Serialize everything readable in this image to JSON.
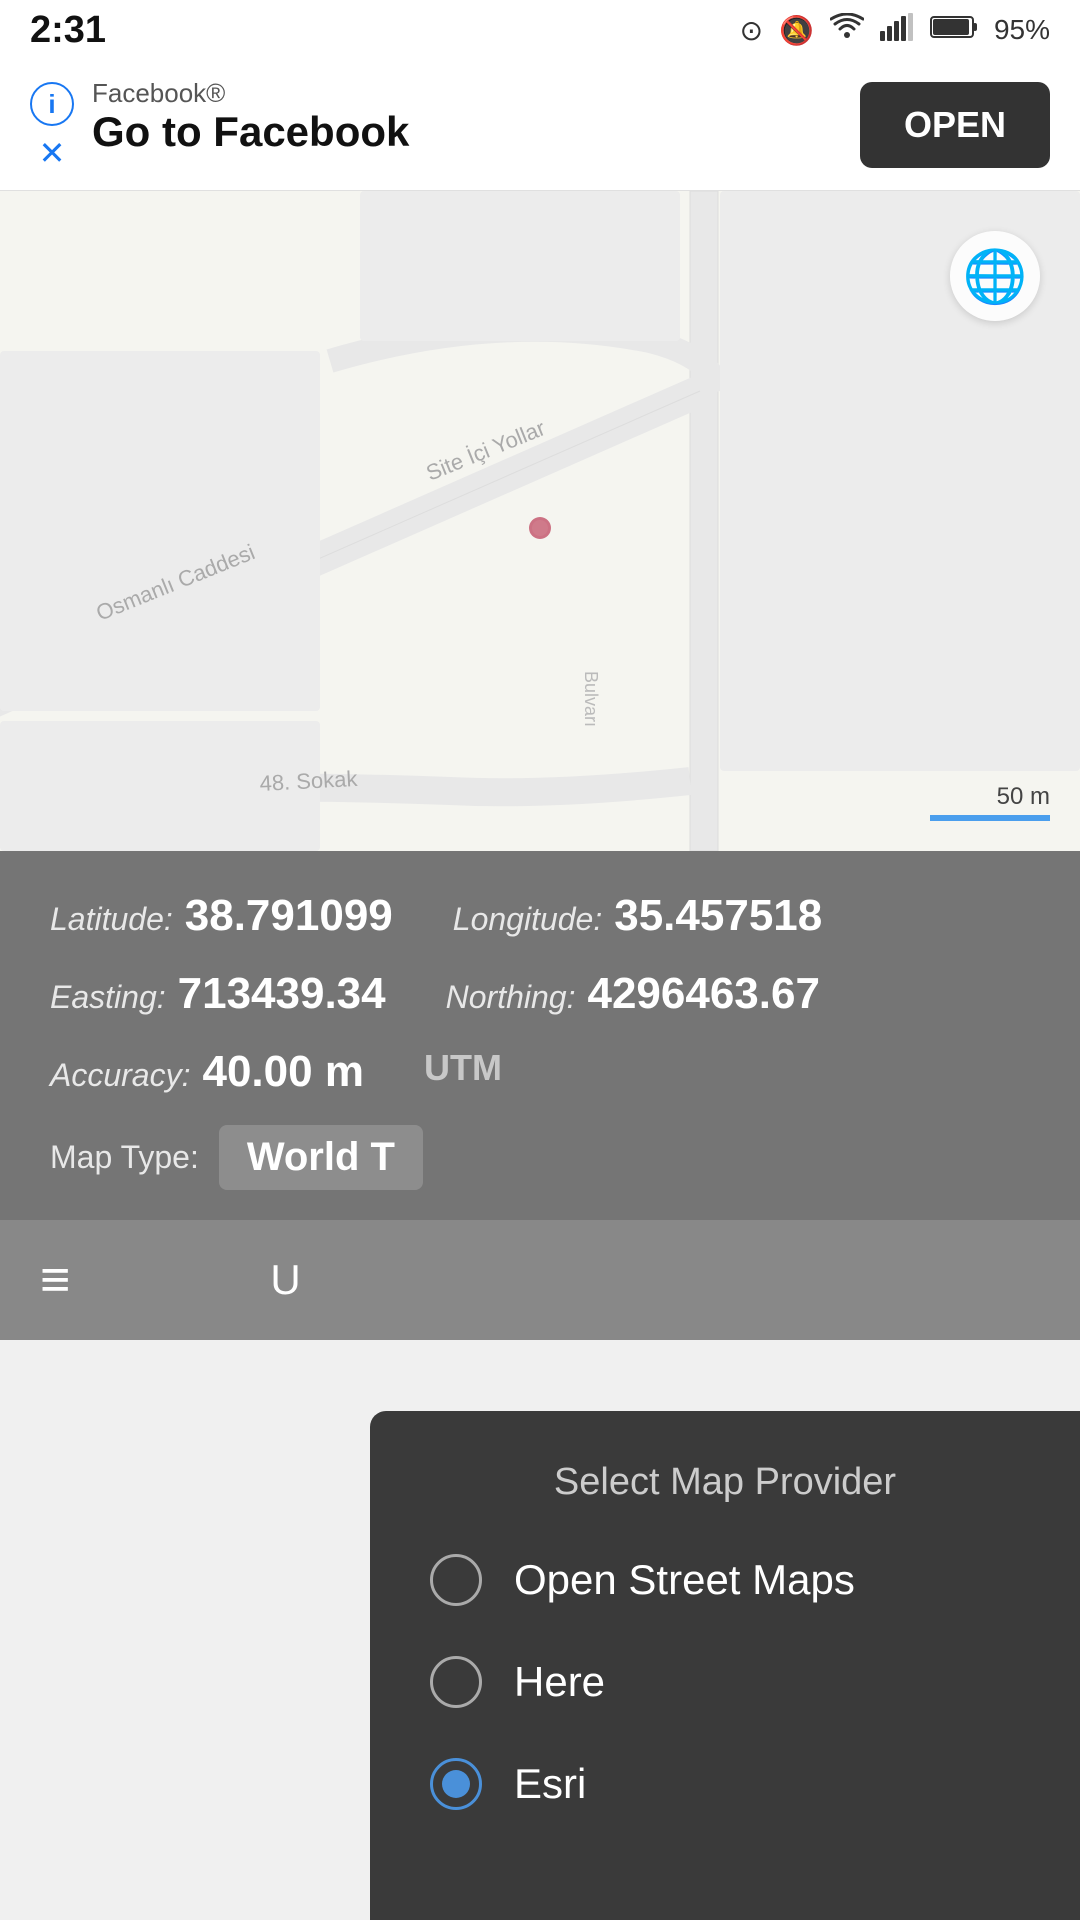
{
  "statusBar": {
    "time": "2:31",
    "battery": "95%"
  },
  "facebookBanner": {
    "appLabel": "Facebook®",
    "title": "Go to Facebook",
    "openButton": "OPEN",
    "infoIcon": "i",
    "closeIcon": "✕"
  },
  "map": {
    "scaleLabel": "50 m",
    "streets": [
      {
        "label": "Site İçi Yollar"
      },
      {
        "label": "Osmanlı Caddesi"
      },
      {
        "label": "48. Sokak"
      }
    ]
  },
  "infoPanel": {
    "latLabel": "Latitude:",
    "latValue": "38.791099",
    "lonLabel": "Longitude:",
    "lonValue": "35.457518",
    "eastLabel": "Easting:",
    "eastValue": "713439.34",
    "northLabel": "Northing:",
    "northValue": "4296463.67",
    "accLabel": "Accuracy:",
    "accValue": "40.00 m",
    "utmLabel": "UTM",
    "mapTypeLabel": "Map Type:",
    "mapTypeValue": "World T"
  },
  "dropdown": {
    "title": "Select Map Provider",
    "options": [
      {
        "label": "Open Street Maps",
        "selected": false
      },
      {
        "label": "Here",
        "selected": false
      },
      {
        "label": "Esri",
        "selected": true
      }
    ]
  },
  "bottomNav": {
    "hamburger": "≡",
    "uLabel": "U"
  },
  "worldLabel": "World"
}
